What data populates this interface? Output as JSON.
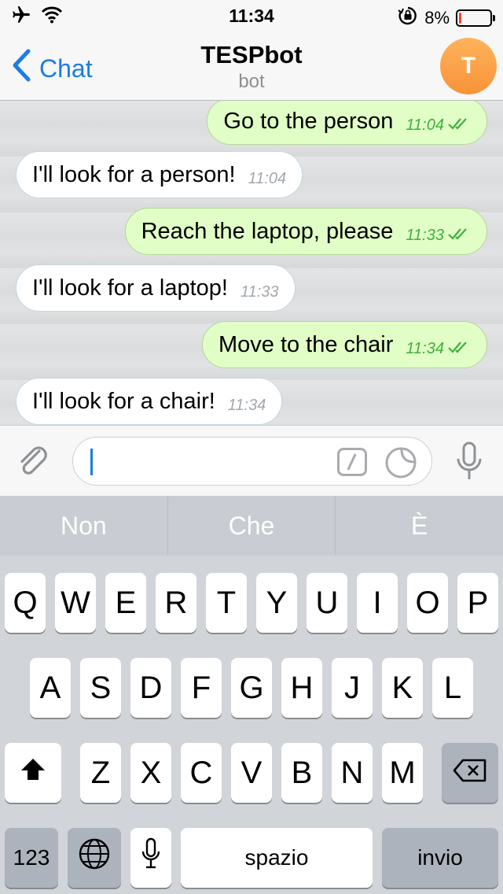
{
  "status_bar": {
    "time": "11:34",
    "battery_text": "8%",
    "battery_level": 0.08
  },
  "nav": {
    "back_label": "Chat",
    "title": "TESPbot",
    "subtitle": "bot",
    "avatar_initial": "T"
  },
  "messages": [
    {
      "direction": "out",
      "text": "Go to the person",
      "time": "11:04"
    },
    {
      "direction": "in",
      "text": "I'll look for a person!",
      "time": "11:04"
    },
    {
      "direction": "out",
      "text": "Reach the laptop, please",
      "time": "11:33"
    },
    {
      "direction": "in",
      "text": "I'll look for a laptop!",
      "time": "11:33"
    },
    {
      "direction": "out",
      "text": "Move to the chair",
      "time": "11:34"
    },
    {
      "direction": "in",
      "text": "I'll look for a chair!",
      "time": "11:34"
    }
  ],
  "input": {
    "value": ""
  },
  "keyboard": {
    "suggestions": [
      "Non",
      "Che",
      "È"
    ],
    "row1": [
      "Q",
      "W",
      "E",
      "R",
      "T",
      "Y",
      "U",
      "I",
      "O",
      "P"
    ],
    "row2": [
      "A",
      "S",
      "D",
      "F",
      "G",
      "H",
      "J",
      "K",
      "L"
    ],
    "row3": [
      "Z",
      "X",
      "C",
      "V",
      "B",
      "N",
      "M"
    ],
    "numbers_label": "123",
    "space_label": "spazio",
    "return_label": "invio"
  },
  "colors": {
    "accent": "#1a7ce8",
    "outgoing_bubble": "#e1fec6",
    "incoming_bubble": "#ffffff",
    "outgoing_time": "#3fb03f",
    "avatar": "#f79337",
    "battery_low": "#ff3b30"
  },
  "icons": {
    "status_left": [
      "airplane-icon",
      "wifi-icon"
    ],
    "status_right": [
      "orientation-lock-icon",
      "battery-icon"
    ],
    "input": [
      "paperclip-icon",
      "bot-command-icon",
      "sticker-icon",
      "microphone-icon"
    ],
    "keyboard": [
      "shift-icon",
      "backspace-icon",
      "globe-icon",
      "dictation-mic-icon"
    ],
    "read_receipt": "double-check-icon"
  }
}
